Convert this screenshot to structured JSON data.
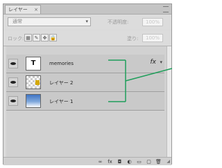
{
  "panel": {
    "tab_title": "レイヤー",
    "tab_close": "×",
    "blend_mode": "通常",
    "opacity_label": "不透明度:",
    "opacity_value": "100%",
    "lock_label": "ロック:",
    "fill_label": "塗り:",
    "fill_value": "100%"
  },
  "lock_icons": [
    {
      "icon": "lock-transparent-icon",
      "glyph": "▦"
    },
    {
      "icon": "lock-brush-icon",
      "glyph": "✎"
    },
    {
      "icon": "lock-move-icon",
      "glyph": "✥"
    },
    {
      "icon": "lock-all-icon",
      "glyph": "🔒"
    }
  ],
  "layers": [
    {
      "name": "memories",
      "thumb_text": "T",
      "has_fx": true,
      "fx_label": "fx",
      "fx_arrow": "▾"
    },
    {
      "name": "レイヤー 2",
      "thumb_text": ""
    },
    {
      "name": "レイヤー 1",
      "thumb_text": ""
    }
  ],
  "bottom_icons": [
    {
      "icon": "link-layers-icon",
      "glyph": "∞"
    },
    {
      "icon": "layer-style-icon",
      "glyph": "fx"
    },
    {
      "icon": "layer-mask-icon",
      "glyph": "◘"
    },
    {
      "icon": "adjustment-layer-icon",
      "glyph": "◐"
    },
    {
      "icon": "new-group-icon",
      "glyph": "▭"
    },
    {
      "icon": "new-layer-icon",
      "glyph": "▢"
    },
    {
      "icon": "delete-layer-icon",
      "glyph": "🗑"
    }
  ],
  "colors": {
    "annotation": "#1e9e5a"
  }
}
